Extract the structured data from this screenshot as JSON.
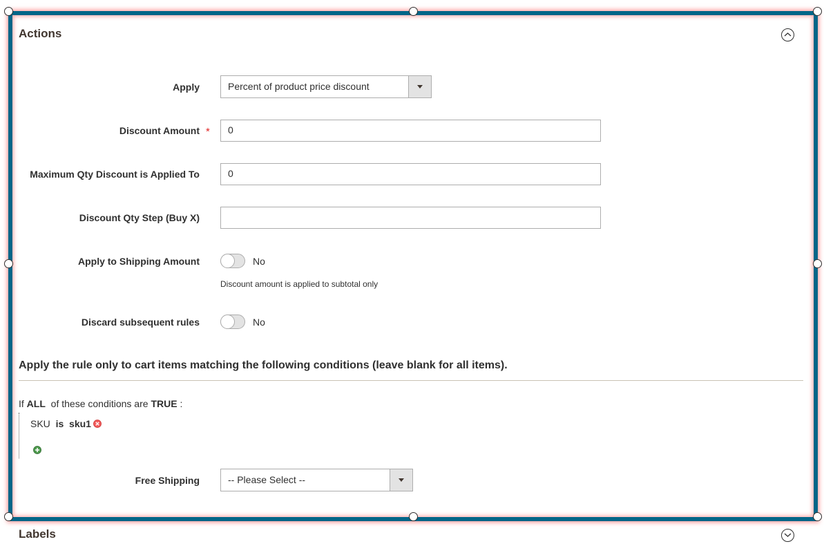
{
  "actions_section": {
    "title": "Actions",
    "collapse_icon": "chevron-up-circle-icon",
    "fields": {
      "apply": {
        "label": "Apply",
        "value": "Percent of product price discount"
      },
      "discount_amount": {
        "label": "Discount Amount",
        "required_mark": "*",
        "value": "0"
      },
      "max_qty": {
        "label": "Maximum Qty Discount is Applied To",
        "value": "0"
      },
      "qty_step": {
        "label": "Discount Qty Step (Buy X)",
        "value": ""
      },
      "apply_shipping": {
        "label": "Apply to Shipping Amount",
        "state": "No",
        "note": "Discount amount is applied to subtotal only"
      },
      "discard_rules": {
        "label": "Discard subsequent rules",
        "state": "No"
      }
    },
    "conditions": {
      "heading": "Apply the rule only to cart items matching the following conditions (leave blank for all items).",
      "if_text": "If",
      "aggregator": "ALL",
      "mid_text": "of these conditions are",
      "value": "TRUE",
      "colon": ":",
      "rule": {
        "attribute": "SKU",
        "operator": "is",
        "value": "sku1",
        "remove_icon": "remove-circle-icon"
      },
      "add_icon": "add-circle-icon"
    },
    "free_shipping": {
      "label": "Free Shipping",
      "value": "-- Please Select --"
    }
  },
  "labels_section": {
    "title": "Labels",
    "expand_icon": "chevron-down-circle-icon"
  }
}
